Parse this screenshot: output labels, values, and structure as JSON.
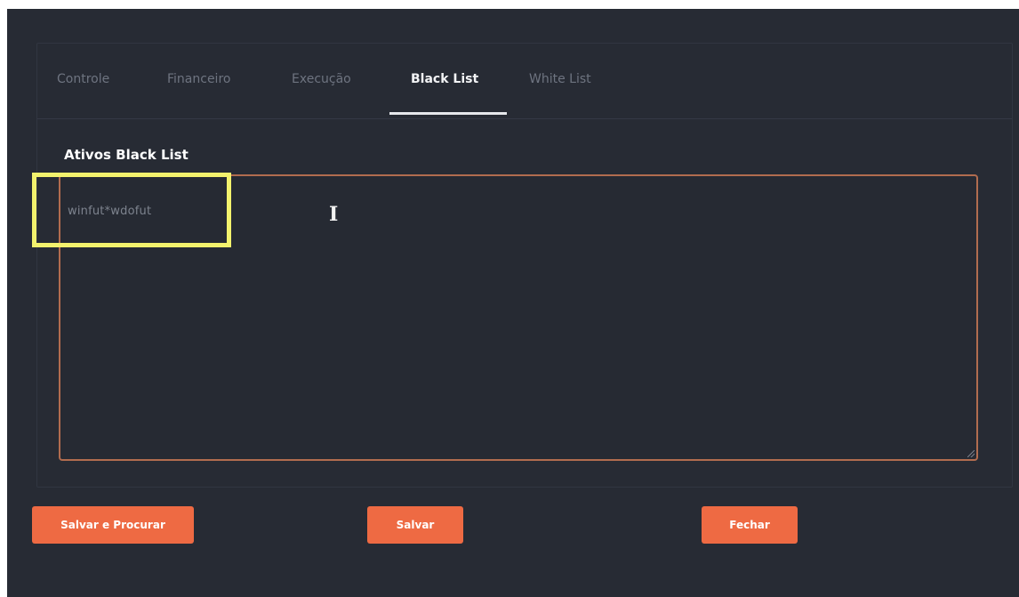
{
  "tabs": [
    {
      "label": "Controle",
      "active": false
    },
    {
      "label": "Financeiro",
      "active": false
    },
    {
      "label": "Execução",
      "active": false
    },
    {
      "label": "Black List",
      "active": true
    },
    {
      "label": "White List",
      "active": false
    }
  ],
  "section": {
    "title": "Ativos Black List"
  },
  "blacklist_input": {
    "value": "winfut*wdofut"
  },
  "buttons": {
    "save_and_search": "Salvar e Procurar",
    "save": "Salvar",
    "close": "Fechar"
  },
  "colors": {
    "background": "#272b34",
    "accent": "#ee6a43",
    "textarea_border": "#b16c4f",
    "highlight": "#f3f26d"
  },
  "icons": {
    "text_cursor": "I"
  }
}
